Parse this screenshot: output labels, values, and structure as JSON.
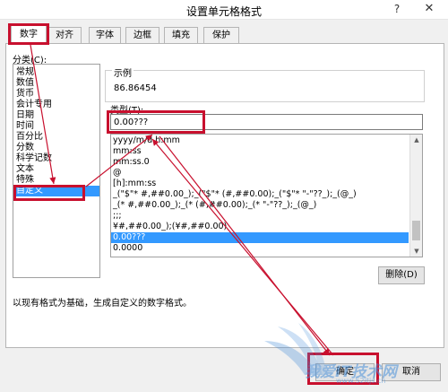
{
  "window": {
    "title": "设置单元格格式",
    "help_label": "?",
    "close_label": "✕"
  },
  "tabs": [
    {
      "label": "数字"
    },
    {
      "label": "对齐"
    },
    {
      "label": "字体"
    },
    {
      "label": "边框"
    },
    {
      "label": "填充"
    },
    {
      "label": "保护"
    }
  ],
  "category": {
    "label": "分类(C):",
    "items": [
      "常规",
      "数值",
      "货币",
      "会计专用",
      "日期",
      "时间",
      "百分比",
      "分数",
      "科学记数",
      "文本",
      "特殊",
      "自定义"
    ],
    "selected": "自定义"
  },
  "sample": {
    "label": "示例",
    "value": "86.86454"
  },
  "type": {
    "label": "类型(T):",
    "value": "0.00???"
  },
  "format_list": {
    "items": [
      "yyyy/m/d h:mm",
      "mm:ss",
      "mm:ss.0",
      "@",
      "[h]:mm:ss",
      "_(\"$\"* #,##0.00_);_(\"$\"* (#,##0.00);_(\"$\"* \"-\"??_);_(@_)",
      "_(* #,##0.00_);_(* (#,##0.00);_(* \"-\"??_);_(@_)",
      ";;;",
      "¥#,##0.00_);(¥#,##0.00)",
      "0.00???",
      "0.0000"
    ],
    "selected": "0.00???"
  },
  "buttons": {
    "delete": "删除(D)",
    "ok": "确定",
    "cancel": "取消"
  },
  "description": "以现有格式为基础，生成自定义的数字格式。",
  "watermark": {
    "text": "我爱IT技术网",
    "url": "www.52itjs.cn"
  },
  "colors": {
    "highlight": "#c8102e",
    "selection": "#3399ff",
    "watermark": "#4a90d9"
  }
}
